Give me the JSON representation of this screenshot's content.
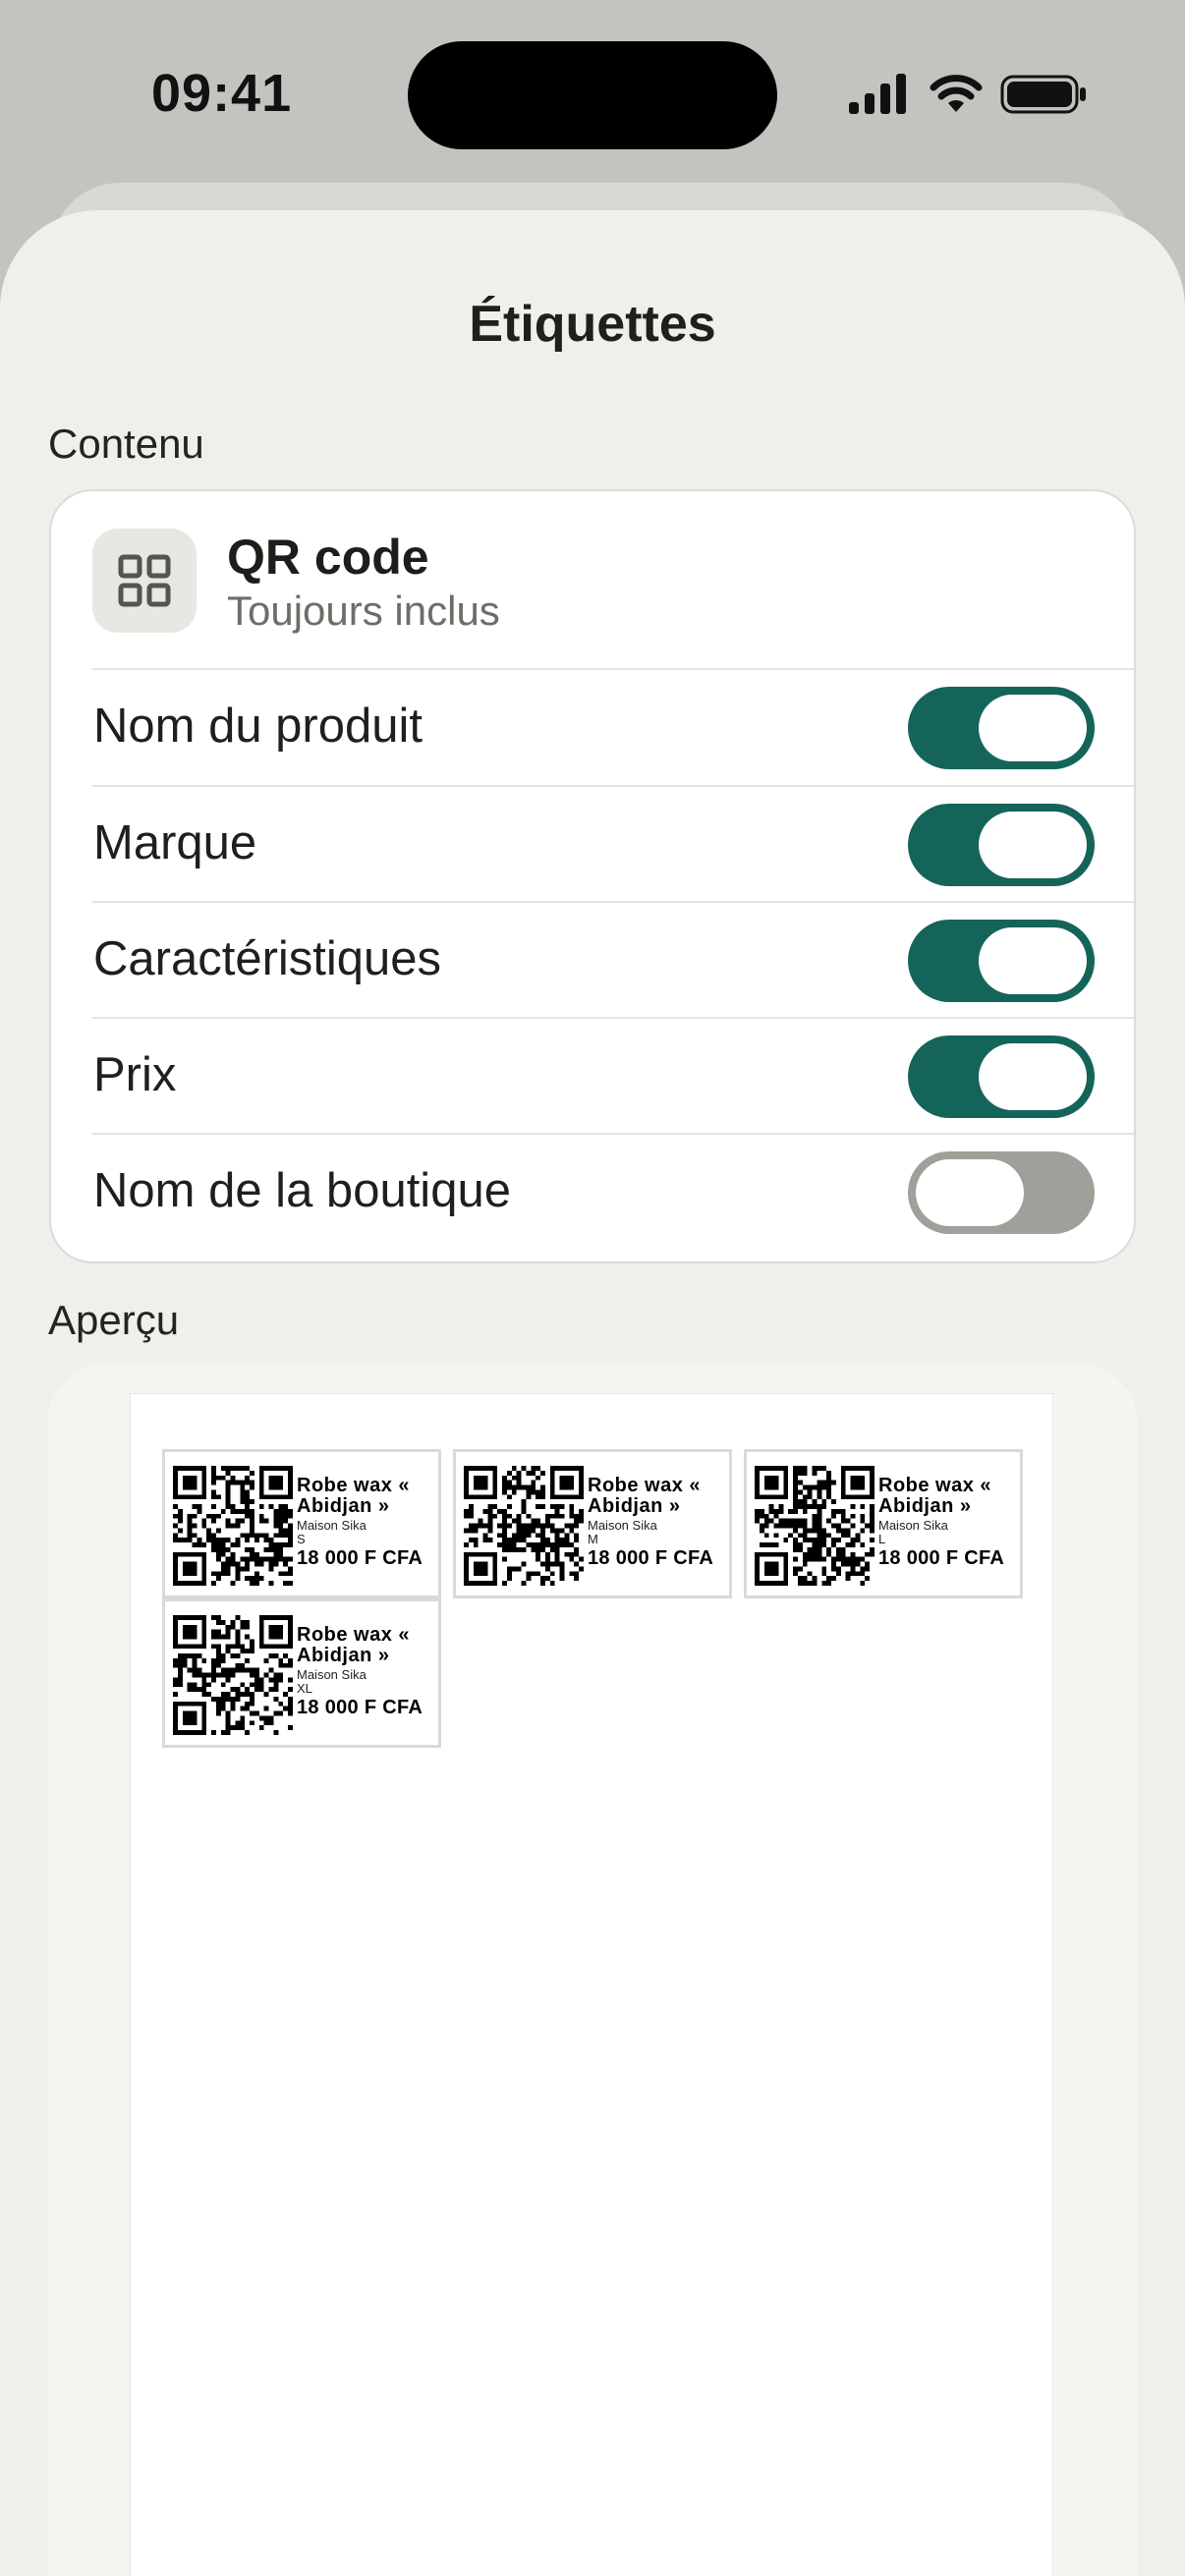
{
  "status_bar": {
    "time": "09:41"
  },
  "sheet": {
    "title": "Étiquettes"
  },
  "content_section": {
    "label": "Contenu",
    "qr": {
      "title": "QR code",
      "subtitle": "Toujours inclus",
      "icon": "grid-icon"
    },
    "options": [
      {
        "label": "Nom du produit",
        "enabled": true
      },
      {
        "label": "Marque",
        "enabled": true
      },
      {
        "label": "Caractéristiques",
        "enabled": true
      },
      {
        "label": "Prix",
        "enabled": true
      },
      {
        "label": "Nom de la boutique",
        "enabled": false
      }
    ]
  },
  "preview_section": {
    "label": "Aperçu",
    "labels": [
      {
        "name": "Robe wax « Abidjan »",
        "brand": "Maison Sika",
        "variant": "S",
        "price": "18 000 F CFA"
      },
      {
        "name": "Robe wax « Abidjan »",
        "brand": "Maison Sika",
        "variant": "M",
        "price": "18 000 F CFA"
      },
      {
        "name": "Robe wax « Abidjan »",
        "brand": "Maison Sika",
        "variant": "L",
        "price": "18 000 F CFA"
      },
      {
        "name": "Robe wax « Abidjan »",
        "brand": "Maison Sika",
        "variant": "XL",
        "price": "18 000 F CFA"
      }
    ]
  },
  "colors": {
    "accent": "#14645a",
    "toggle_off": "#a0a09a",
    "sheet_bg": "#f0efeb"
  }
}
